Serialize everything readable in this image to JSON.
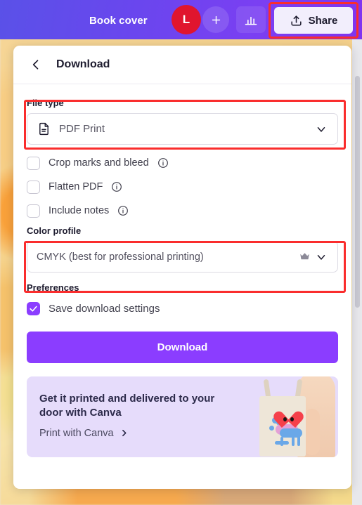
{
  "topbar": {
    "doc_title": "Book cover",
    "avatar_initial": "L",
    "add_label": "+",
    "share_label": "Share",
    "gradient_from": "#5a51e8",
    "gradient_to": "#8034f0",
    "avatar_color": "#e0152e",
    "share_bg": "#f2eefc"
  },
  "highlight": {
    "color": "#fa2d2d"
  },
  "panel": {
    "title": "Download",
    "back_icon": "chevron-left-icon",
    "file_type": {
      "label": "File type",
      "value": "PDF Print",
      "icon": "pdf-file-icon",
      "chevron": "chevron-down-icon"
    },
    "options": [
      {
        "label": "Crop marks and bleed",
        "checked": false,
        "info": true
      },
      {
        "label": "Flatten PDF",
        "checked": false,
        "info": true
      },
      {
        "label": "Include notes",
        "checked": false,
        "info": true
      }
    ],
    "color_profile": {
      "label": "Color profile",
      "value": "CMYK (best for professional printing)",
      "badge_icon": "crown-icon",
      "chevron": "chevron-down-icon"
    },
    "preferences": {
      "label": "Preferences",
      "save_settings_label": "Save download settings",
      "save_settings_checked": true,
      "checked_color": "#8b3dff"
    },
    "download_button": {
      "label": "Download",
      "color": "#8b3dff"
    },
    "promo": {
      "title": "Get it printed and delivered to your door with Canva",
      "link_label": "Print with Canva",
      "link_icon": "chevron-right-icon",
      "bg": "#e6dcfb"
    }
  }
}
